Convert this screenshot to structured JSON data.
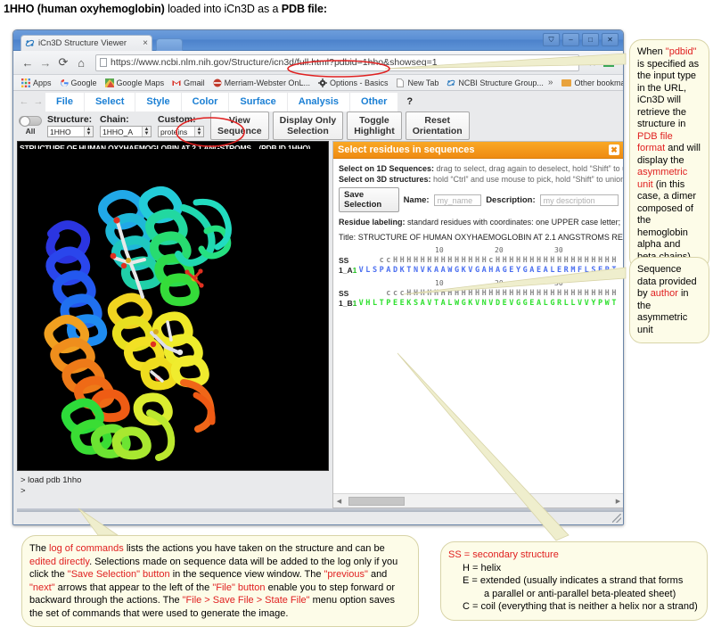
{
  "caption": {
    "bold1": "1HHO (human oxyhemoglobin)",
    "mid": " loaded into iCn3D as a ",
    "bold2": "PDB file",
    "end": ":"
  },
  "browser": {
    "tab_title": "iCn3D Structure Viewer",
    "tab_close": "×",
    "url": "https://www.ncbi.nlm.nih.gov/Structure/icn3d/full.html?pdbid=1hho&showseq=1",
    "back_icon": "←",
    "forward_icon": "→",
    "reload_icon": "⟳",
    "home_icon": "⌂",
    "star_icon": "☆",
    "menu_icon": "hamburger-icon",
    "window_controls": {
      "user": "⛉",
      "minimize": "–",
      "maximize": "□",
      "close": "✕"
    },
    "bookmarks": [
      {
        "label": "Apps",
        "icon": "apps-grid-icon"
      },
      {
        "label": "Google",
        "icon": "google-g-icon"
      },
      {
        "label": "Google Maps",
        "icon": "maps-icon"
      },
      {
        "label": "Gmail",
        "icon": "gmail-m-icon"
      },
      {
        "label": "Merriam-Webster OnL...",
        "icon": "merriam-webster-icon"
      },
      {
        "label": "Options - Basics",
        "icon": "gear-icon"
      },
      {
        "label": "New Tab",
        "icon": "page-icon"
      },
      {
        "label": "NCBI Structure Group...",
        "icon": "icn3d-icon"
      }
    ],
    "overflow_chevron": "»",
    "other_bookmarks": "Other bookmarks"
  },
  "icn3d": {
    "nav_prev": "←",
    "nav_next": "→",
    "menus": [
      "File",
      "Select",
      "Style",
      "Color",
      "Surface",
      "Analysis",
      "Other"
    ],
    "help": "?",
    "toggle_all_label": "All",
    "selectors": [
      {
        "label": "Structure:",
        "value": "1HHO"
      },
      {
        "label": "Chain:",
        "value": "1HHO_A"
      },
      {
        "label": "Custom:",
        "value": "proteins"
      }
    ],
    "buttons": [
      {
        "label_l1": "View",
        "label_l2": "Sequence"
      },
      {
        "label_l1": "Display Only",
        "label_l2": "Selection"
      },
      {
        "label_l1": "Toggle",
        "label_l2": "Highlight"
      },
      {
        "label_l1": "Reset",
        "label_l2": "Orientation"
      }
    ],
    "viewer_title": "STRUCTURE OF HUMAN OXYHAEMOGLOBIN AT 2.1 ANGSTROMS... (PDB ID 1HHO)",
    "command_log": {
      "line1": "> load pdb 1hho",
      "line2": ">"
    }
  },
  "sequence_dialog": {
    "title": "Select residues in sequences",
    "close": "✖",
    "hint1_bold": "Select on 1D Sequences:",
    "hint1_rest": " drag to select, drag again to deselect, hold “Shift” to union",
    "hint2_bold": "Select on 3D structures:",
    "hint2_rest": " hold “Ctrl” and use mouse to pick, hold “Shift” to union sele",
    "save_button": "Save Selection",
    "name_label": "Name:",
    "name_placeholder": "my_name",
    "desc_label": "Description:",
    "desc_placeholder": "my description",
    "residue_label_bold": "Residue labeling:",
    "residue_label_rest": " standard residues with coordinates: one UPPER case letter; nonsta",
    "title_label": "Title:",
    "title_value": "STRUCTURE OF HUMAN OXYHAEMOGLOBIN AT 2.1 ANGSTROMS RESOLUTION",
    "ruler_ticks": [
      "10",
      "20",
      "30"
    ],
    "blocks": [
      {
        "ss_label": "SS",
        "ss_value": "ccHHHHHHHHHHHHHHcHHHHHHHHHHHHHHHHHH",
        "chain_label": "1_A",
        "start_number": "1",
        "residues": "VLSPADKTNVKAAWGKVGAHAGEYGAEALERMFLSFPT",
        "color": "#4a6ef0"
      },
      {
        "ss_label": "SS",
        "ss_value": "cccHHHHHHHHHHHHHHHHHHHHHHHHHHHHHHH",
        "chain_label": "1_B",
        "start_number": "1",
        "residues": "VHLTPEEKSAVTALWGKVNVDEVGGEALGRLLVVYPWT",
        "color": "#2ee02e"
      }
    ]
  },
  "callouts": {
    "pdbid": {
      "p1": "When ",
      "q1": "\"pdbid\"",
      "p2": " is specified as the input type in the URL, iCn3D will retrieve the structure in ",
      "r1": "PDB file format",
      "p3": " and will display the ",
      "r2": "asymmetric unit",
      "p4": " (in this case, a dimer composed of the hemoglobin alpha and beta chains)"
    },
    "seqdata": {
      "p1": "Sequence data provided by ",
      "r1": "author",
      "p2": " in the asymmetric unit"
    },
    "cmdlog": {
      "p1": "The ",
      "r1": "log of commands",
      "p2": " lists the actions you have taken on the structure and can be ",
      "r2": "edited directly",
      "p3": ". Selections made on sequence data will be added to the log only if you click the ",
      "r3": "\"Save Selection\" button",
      "p4": " in the sequence view window. The ",
      "r4": "\"previous\"",
      "p5": " and ",
      "r5": "\"next\"",
      "p6": " arrows that appear to the left of the ",
      "r6": "\"File\" button",
      "p7": " enable you to step forward or backward through the actions. The ",
      "r7": "\"File > Save File > State File\"",
      "p8": " menu option saves the set of commands that were used to generate the image."
    },
    "ss_legend": {
      "head_r": "SS",
      "head_rest": " = secondary structure",
      "l1": "H = helix",
      "l2": "E = extended (usually indicates a strand that forms",
      "l3": "a parallel or anti-parallel beta-pleated sheet)",
      "l4": "C = coil (everything that is neither a helix nor a strand)"
    }
  },
  "colors": {
    "accent_orange": "#ef8b12",
    "menu_blue": "#1a7fd4",
    "annotation_red": "#e02020",
    "callout_bg": "#fdfce8",
    "chain_a": "#4a6ef0",
    "chain_b": "#2ee02e",
    "ss_gray": "#8a8a8a",
    "seq_number_green": "#1fbf1f"
  }
}
